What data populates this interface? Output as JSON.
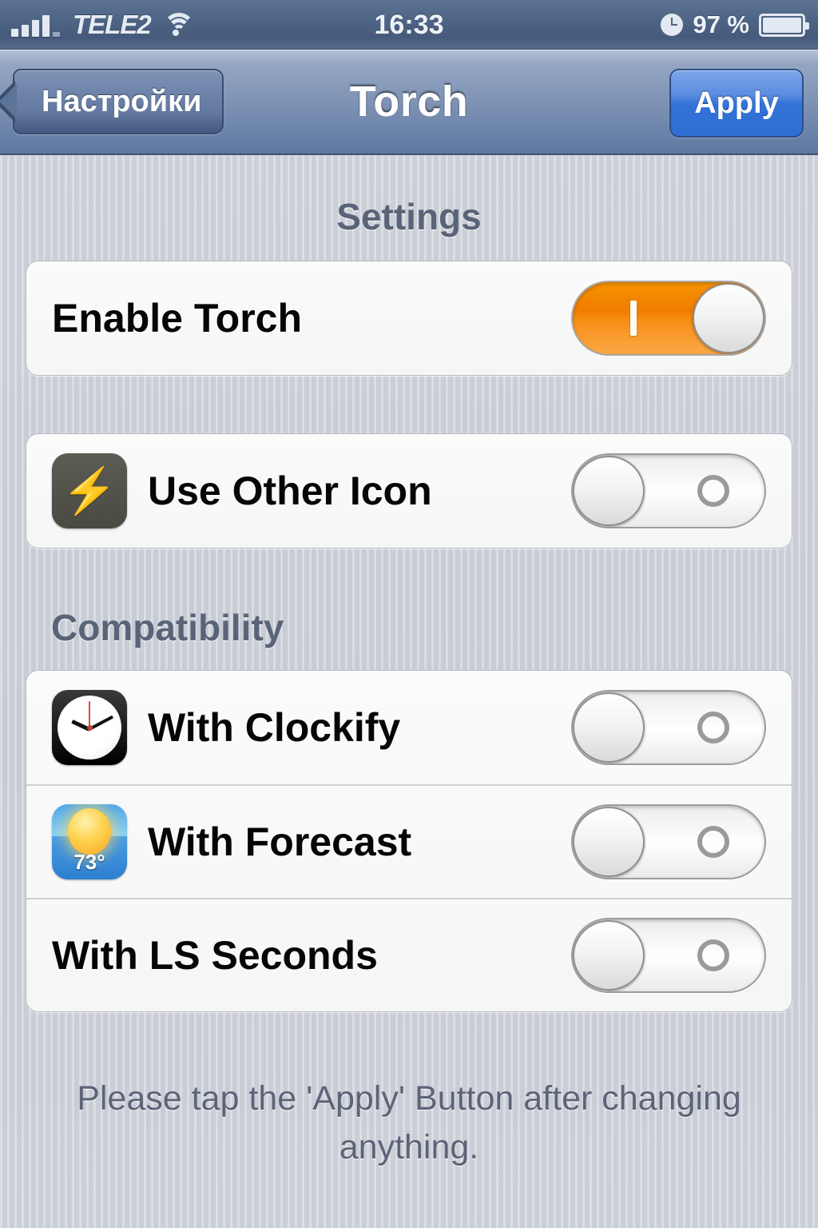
{
  "status_bar": {
    "carrier": "TELE2",
    "signal_bars": 5,
    "wifi_icon": "wifi-icon",
    "time": "16:33",
    "alarm_icon": "alarm-clock-icon",
    "battery_percent": "97 %",
    "battery_icon": "battery-icon"
  },
  "nav_bar": {
    "back_label": "Настройки",
    "title": "Torch",
    "apply_label": "Apply",
    "apply_color": "#3272d6"
  },
  "sections": [
    {
      "header": "Settings",
      "header_align": "center",
      "rows": [
        {
          "label": "Enable Torch",
          "icon": null,
          "toggle_state": "on",
          "toggle_on_color": "#f07c00"
        }
      ]
    },
    {
      "header": "",
      "header_align": "center",
      "rows": [
        {
          "label": "Use Other Icon",
          "icon": "lightning-bolt-icon",
          "icon_glyph": "⚡",
          "toggle_state": "off"
        }
      ]
    },
    {
      "header": "Compatibility",
      "header_align": "left",
      "rows": [
        {
          "label": "With Clockify",
          "icon": "clock-app-icon",
          "toggle_state": "off"
        },
        {
          "label": "With Forecast",
          "icon": "weather-app-icon",
          "icon_temperature": "73°",
          "toggle_state": "off"
        },
        {
          "label": "With LS Seconds",
          "icon": null,
          "toggle_state": "off"
        }
      ]
    }
  ],
  "footer": {
    "note": "Please tap the 'Apply' Button after changing anything."
  }
}
